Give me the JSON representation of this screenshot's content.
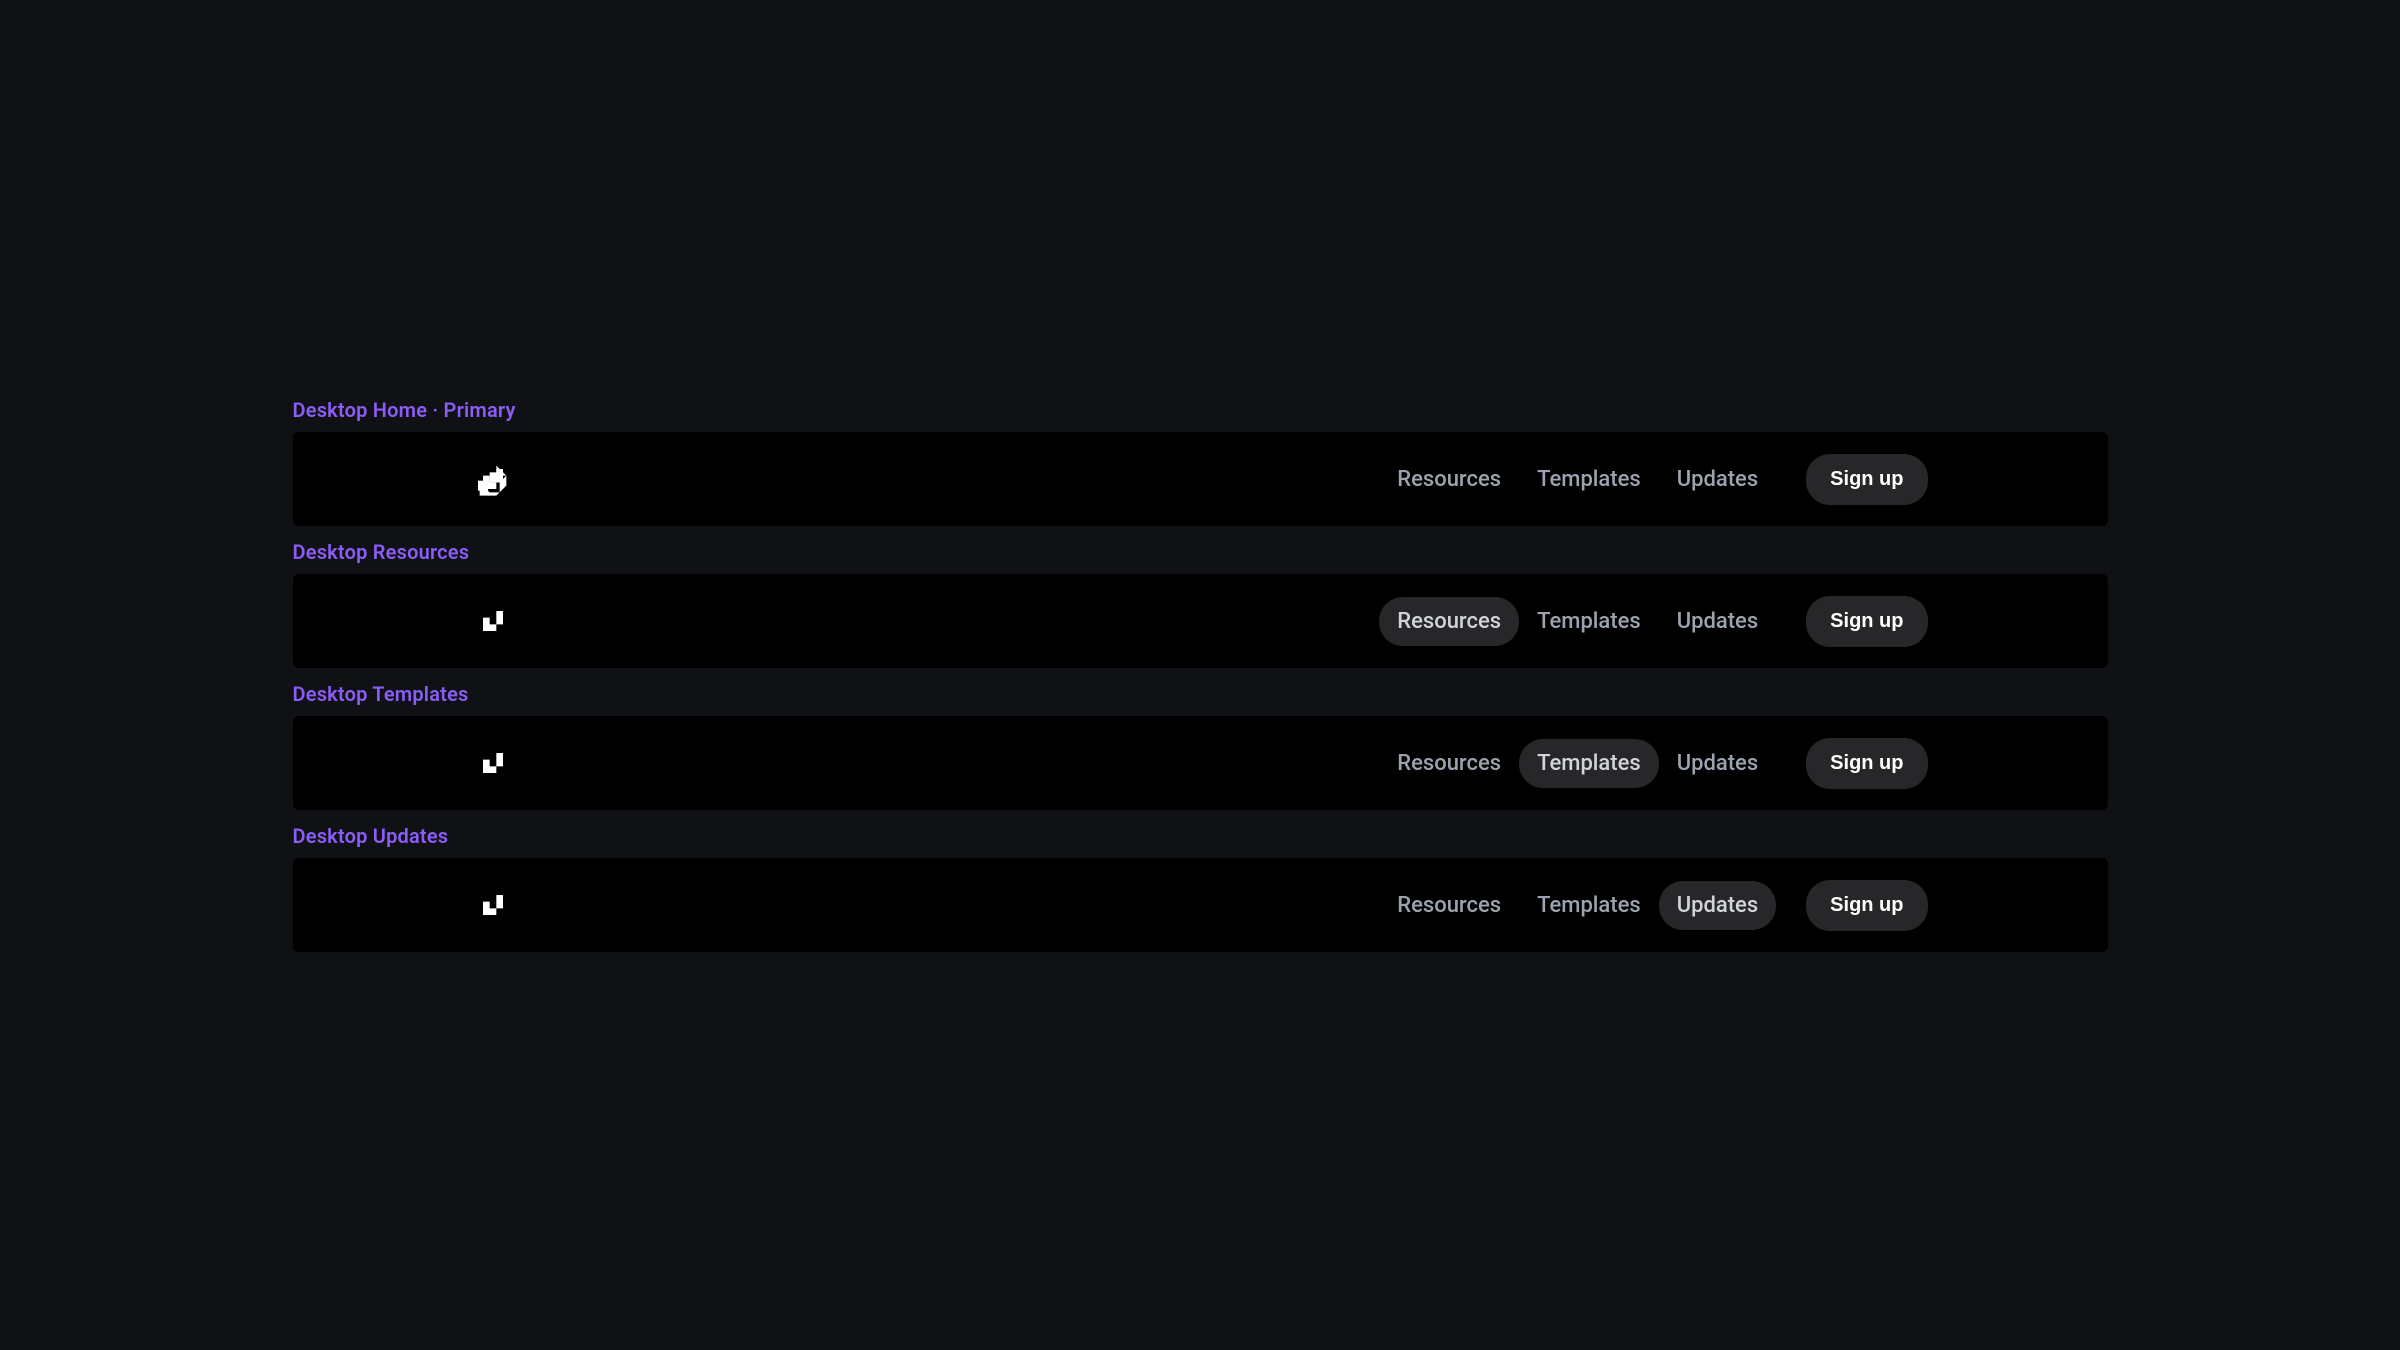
{
  "variants": [
    {
      "label": "Desktop Home · Primary",
      "nav": {
        "resources": "Resources",
        "templates": "Templates",
        "updates": "Updates",
        "signup": "Sign up"
      },
      "active": null
    },
    {
      "label": "Desktop Resources",
      "nav": {
        "resources": "Resources",
        "templates": "Templates",
        "updates": "Updates",
        "signup": "Sign up"
      },
      "active": "resources"
    },
    {
      "label": "Desktop Templates",
      "nav": {
        "resources": "Resources",
        "templates": "Templates",
        "updates": "Updates",
        "signup": "Sign up"
      },
      "active": "templates"
    },
    {
      "label": "Desktop Updates",
      "nav": {
        "resources": "Resources",
        "templates": "Templates",
        "updates": "Updates",
        "signup": "Sign up"
      },
      "active": "updates"
    }
  ]
}
